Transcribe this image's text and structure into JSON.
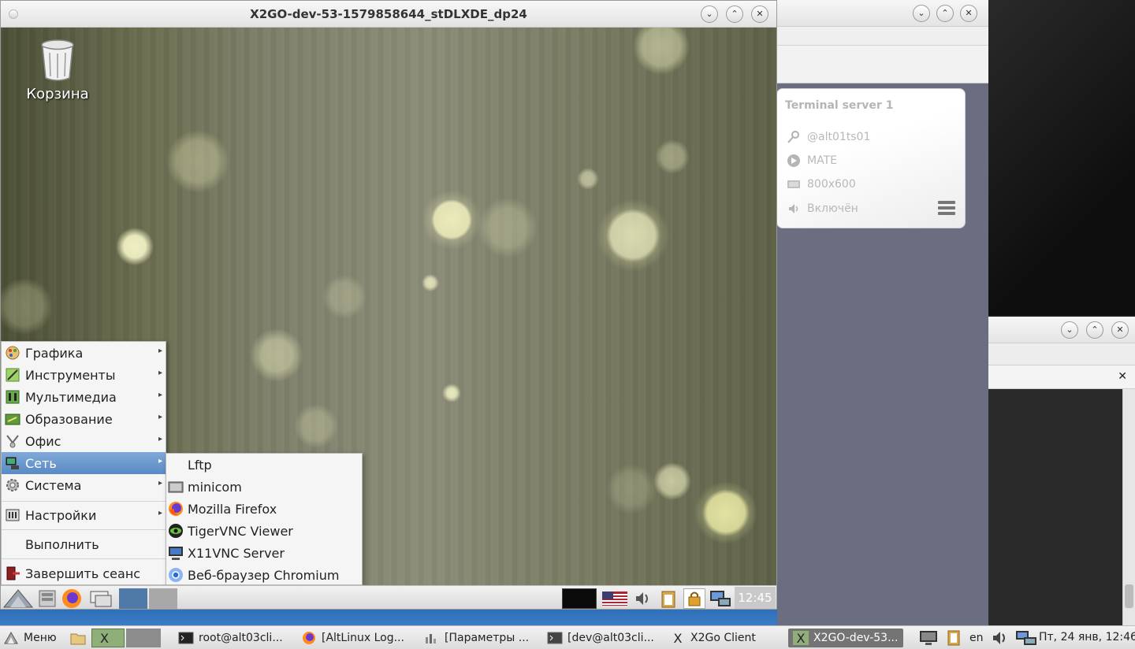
{
  "session_window": {
    "title": "X2GO-dev-53-1579858644_stDLXDE_dp24"
  },
  "desktop": {
    "trash_label": "Корзина"
  },
  "main_menu": {
    "items": [
      {
        "label": "Графика",
        "icon": "graphics-icon",
        "submenu": true
      },
      {
        "label": "Инструменты",
        "icon": "tools-icon",
        "submenu": true
      },
      {
        "label": "Мультимедиа",
        "icon": "multimedia-icon",
        "submenu": true
      },
      {
        "label": "Образование",
        "icon": "education-icon",
        "submenu": true
      },
      {
        "label": "Офис",
        "icon": "office-icon",
        "submenu": true
      },
      {
        "label": "Сеть",
        "icon": "network-icon",
        "submenu": true,
        "active": true
      },
      {
        "label": "Система",
        "icon": "system-icon",
        "submenu": true
      },
      {
        "label": "Настройки",
        "icon": "settings-icon",
        "submenu": true
      },
      {
        "label": "Выполнить",
        "icon": "",
        "submenu": false
      },
      {
        "label": "Завершить сеанс",
        "icon": "logout-icon",
        "submenu": false
      }
    ],
    "arrow": "▸"
  },
  "sub_menu": {
    "items": [
      {
        "label": "Lftp",
        "icon": "lftp-icon"
      },
      {
        "label": "minicom",
        "icon": "minicom-icon"
      },
      {
        "label": "Mozilla Firefox",
        "icon": "firefox-icon"
      },
      {
        "label": "TigerVNC Viewer",
        "icon": "tigervnc-icon"
      },
      {
        "label": "X11VNC Server",
        "icon": "x11vnc-icon"
      },
      {
        "label": "Веб-браузер Chromium",
        "icon": "chromium-icon"
      }
    ]
  },
  "session_panel": {
    "clock": "12:45"
  },
  "client_window": {
    "session_card": {
      "title": "Terminal server 1",
      "server": "@alt01ts01",
      "desktop": "MATE",
      "resolution": "800x600",
      "sound": "Включён"
    }
  },
  "host_taskbar": {
    "menu_label": "Меню",
    "tasks": [
      {
        "label": "root@alt03cli...",
        "icon": "terminal-icon"
      },
      {
        "label": "[AltLinux Log...",
        "icon": "firefox-icon"
      },
      {
        "label": "[Параметры ...",
        "icon": "settings-icon"
      },
      {
        "label": "[dev@alt03cli...",
        "icon": "terminal-icon"
      },
      {
        "label": "X2Go Client",
        "icon": "x2go-icon"
      },
      {
        "label": "X2GO-dev-53...",
        "icon": "x2go-icon",
        "active": true
      }
    ],
    "keyboard_layout": "en",
    "clock": "Пт, 24 янв, 12:46"
  },
  "colors": {
    "menu_highlight": "#5a8ac4",
    "taskbar_active": "#747474",
    "client_bg": "#6b6e80"
  }
}
